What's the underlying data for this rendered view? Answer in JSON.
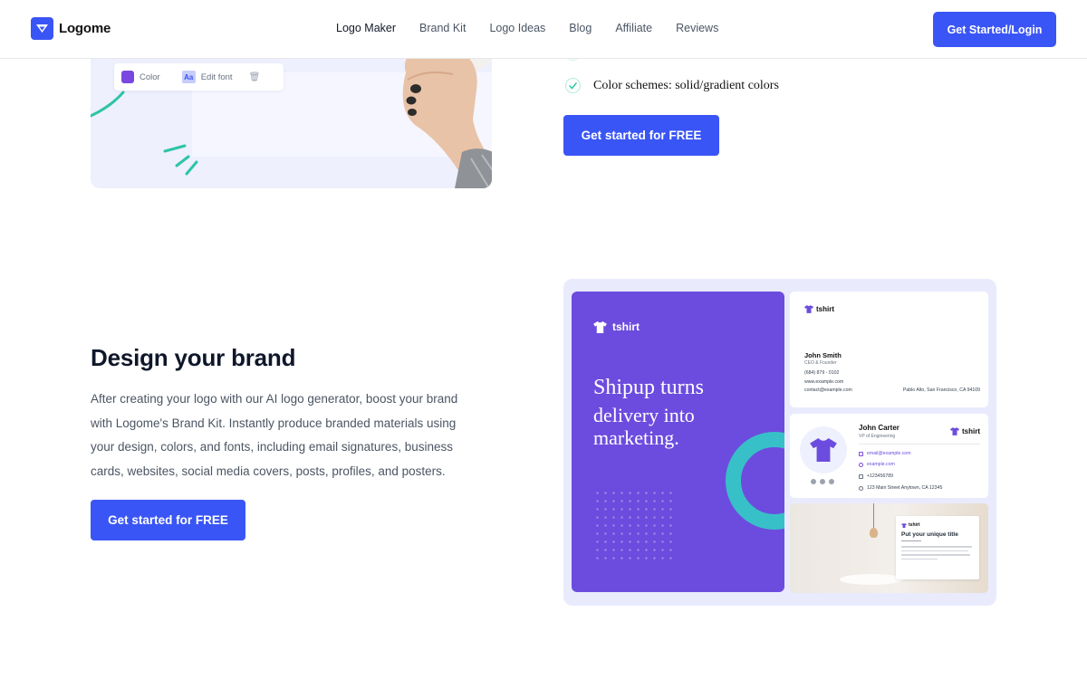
{
  "header": {
    "brand_name": "Logome",
    "nav": [
      "Logo Maker",
      "Brand Kit",
      "Logo Ideas",
      "Blog",
      "Affiliate",
      "Reviews"
    ],
    "login_button": "Get Started/Login"
  },
  "top_section": {
    "toolbar": {
      "color_label": "Color",
      "font_icon_label": "Aa",
      "font_label": "Edit font"
    },
    "feature": "Color schemes: solid/gradient colors",
    "cta": "Get started for FREE"
  },
  "brand_section": {
    "heading": "Design your brand",
    "paragraph": "After creating your logo with our AI logo generator, boost your brand with Logome's Brand Kit. Instantly produce branded materials using your design, colors, and fonts, including email signatures, business cards, websites, social media covers, posts, profiles, and posters.",
    "cta": "Get started for FREE",
    "mockup": {
      "brand": "tshirt",
      "headline_line1": "Shipup turns",
      "headline_line2": "delivery into",
      "headline_line3": "marketing.",
      "business_card": {
        "name": "John Smith",
        "role": "CEO & Founder",
        "phone": "(684) 879 - 0102",
        "website": "www.example.com",
        "email": "contact@example.com",
        "address": "Pablo Alto, San Francisco, CA 94109"
      },
      "signature": {
        "name": "John Carter",
        "role": "VP of Engineering",
        "email": "email@example.com",
        "website": "example.com",
        "phone": "+123456789",
        "address": "123 Main Street Anytown, CA 12345"
      },
      "post": {
        "title": "Put your unique title"
      }
    }
  },
  "colors": {
    "primary": "#3a55f5",
    "purple": "#6c4cde",
    "teal": "#38c0c8",
    "mint": "#2ec4a6"
  }
}
